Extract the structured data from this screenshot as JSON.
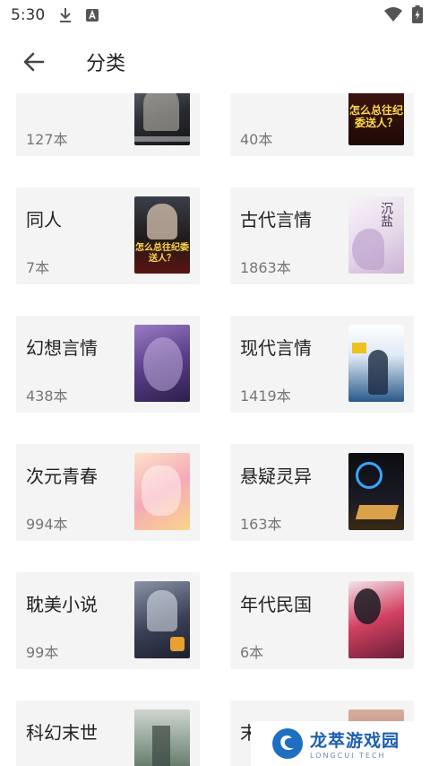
{
  "status": {
    "time": "5:30",
    "icons": [
      "download-icon",
      "a-badge-icon",
      "wifi-icon",
      "battery-icon"
    ]
  },
  "header": {
    "title": "分类",
    "back_icon": "arrow-left-icon"
  },
  "categories": [
    {
      "name": "",
      "count": "127本",
      "cover": "dark-portrait"
    },
    {
      "name": "",
      "count": "40本",
      "cover": "red-title"
    },
    {
      "name": "同人",
      "count": "7本",
      "cover": "red-title-portrait"
    },
    {
      "name": "古代言情",
      "count": "1863本",
      "cover": "white-purple"
    },
    {
      "name": "幻想言情",
      "count": "438本",
      "cover": "purple-fantasy"
    },
    {
      "name": "现代言情",
      "count": "1419本",
      "cover": "blue-girl"
    },
    {
      "name": "次元青春",
      "count": "994本",
      "cover": "anime-pink"
    },
    {
      "name": "悬疑灵异",
      "count": "163本",
      "cover": "dark-book"
    },
    {
      "name": "耽美小说",
      "count": "99本",
      "cover": "dark-anime"
    },
    {
      "name": "年代民国",
      "count": "6本",
      "cover": "red-lady"
    },
    {
      "name": "科幻末世",
      "count": "",
      "cover": "green-city"
    },
    {
      "name": "末世",
      "count": "",
      "cover": "brown"
    }
  ],
  "covers": {
    "red_title_text": "怎么总往纪委送人？",
    "ancient_title": "沉盐"
  },
  "watermark": {
    "title": "龙萃游戏园",
    "subtitle": "LONGCUI TECH"
  },
  "colors": {
    "card_bg": "#f4f4f4",
    "text_primary": "#222222",
    "text_secondary": "#777777",
    "watermark_blue": "#1a5fb0"
  }
}
